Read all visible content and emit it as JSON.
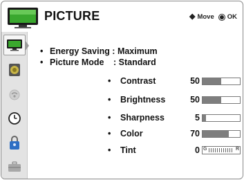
{
  "header": {
    "title": "PICTURE",
    "hint_move": "Move",
    "hint_ok": "OK"
  },
  "sidebar": {
    "items": [
      {
        "icon": "picture-icon",
        "active": true
      },
      {
        "icon": "audio-icon",
        "active": false
      },
      {
        "icon": "channel-icon",
        "active": false
      },
      {
        "icon": "clock-icon",
        "active": false
      },
      {
        "icon": "lock-icon",
        "active": false
      },
      {
        "icon": "option-icon",
        "active": false
      }
    ]
  },
  "settings": {
    "energy_saving": "Energy Saving : Maximum",
    "picture_mode_label": "Picture Mode",
    "picture_mode_value": ": Standard"
  },
  "adjustments": [
    {
      "label": "Contrast",
      "value": "50",
      "level": 0.5
    },
    {
      "label": "Brightness",
      "value": "50",
      "level": 0.5
    },
    {
      "label": "Sharpness",
      "value": "5",
      "level": 0.1
    },
    {
      "label": "Color",
      "value": "70",
      "level": 0.7
    },
    {
      "label": "Tint",
      "value": "0",
      "type": "tint",
      "left_mark": "G",
      "right_mark": "R"
    }
  ],
  "colors": {
    "accent_green": "#3aa82e",
    "bar_fill": "#7e7e7e",
    "sidebar_bg": "#e3e3e3"
  }
}
